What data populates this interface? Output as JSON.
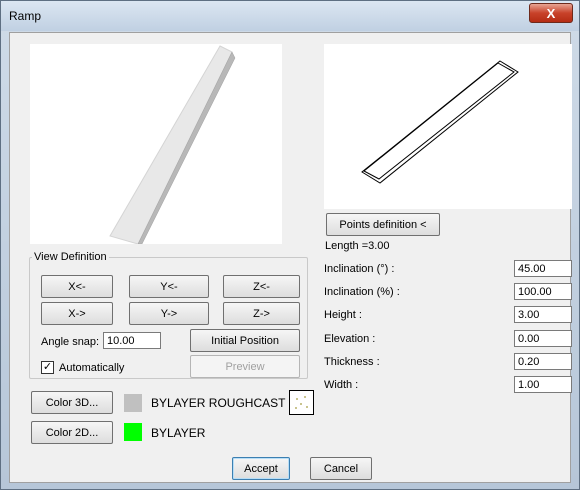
{
  "window": {
    "title": "Ramp",
    "close_glyph": "X"
  },
  "preview": {
    "points_definition_label": "Points definition <",
    "length_text": "Length =3.00"
  },
  "view_definition": {
    "legend": "View Definition",
    "buttons": [
      "X<-",
      "Y<-",
      "Z<-",
      "X->",
      "Y->",
      "Z->"
    ],
    "angle_snap_label": "Angle snap:",
    "angle_snap_value": "10.00",
    "initial_position_label": "Initial Position",
    "automatically_label": "Automatically",
    "automatically_checked": true,
    "preview_label": "Preview"
  },
  "params": [
    {
      "label": "Inclination (°) :",
      "value": "45.00"
    },
    {
      "label": "Inclination (%) :",
      "value": "100.00"
    },
    {
      "label": "Height :",
      "value": "3.00"
    },
    {
      "label": "Elevation :",
      "value": "0.00"
    },
    {
      "label": "Thickness :",
      "value": "0.20"
    },
    {
      "label": "Width :",
      "value": "1.00"
    }
  ],
  "color3d": {
    "button_label": "Color 3D...",
    "swatch_color": "#c0c0c0",
    "value_text": "BYLAYER ROUGHCAST"
  },
  "color2d": {
    "button_label": "Color 2D...",
    "swatch_color": "#00ff00",
    "value_text": "BYLAYER"
  },
  "footer": {
    "accept_label": "Accept",
    "cancel_label": "Cancel"
  }
}
